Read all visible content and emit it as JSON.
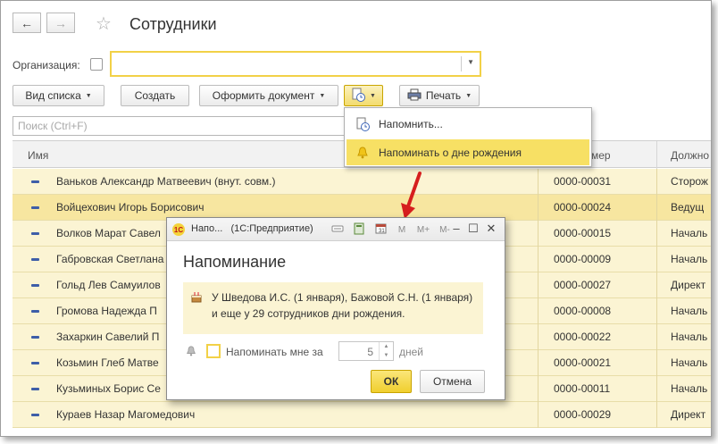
{
  "header": {
    "title": "Сотрудники",
    "back_icon": "←",
    "forward_icon": "→",
    "star_icon": "☆"
  },
  "filter": {
    "org_label": "Организация:"
  },
  "toolbar": {
    "view_list": "Вид списка",
    "create": "Создать",
    "make_document": "Оформить документ",
    "print": "Печать"
  },
  "search": {
    "placeholder": "Поиск (Ctrl+F)"
  },
  "table": {
    "columns": {
      "name": "Имя",
      "number": "мер",
      "position": "Должно"
    },
    "rows": [
      {
        "name": "Ваньков Александр Матвеевич (внут. совм.)",
        "number": "0000-00031",
        "position": "Сторож"
      },
      {
        "name": "Войцехович Игорь Борисович",
        "number": "0000-00024",
        "position": "Ведущ"
      },
      {
        "name": "Волков Марат Савел",
        "number": "0000-00015",
        "position": "Началь"
      },
      {
        "name": "Габровская Светлана",
        "number": "0000-00009",
        "position": "Началь"
      },
      {
        "name": "Гольд Лев Самуилов",
        "number": "0000-00027",
        "position": "Директ"
      },
      {
        "name": "Громова Надежда П",
        "number": "0000-00008",
        "position": "Началь"
      },
      {
        "name": "Захаркин Савелий П",
        "number": "0000-00022",
        "position": "Началь"
      },
      {
        "name": "Козьмин Глеб Матве",
        "number": "0000-00021",
        "position": "Началь"
      },
      {
        "name": "Кузьминых Борис Се",
        "number": "0000-00011",
        "position": "Началь"
      },
      {
        "name": "Кураев Назар Магомедович",
        "number": "0000-00029",
        "position": "Директ"
      }
    ]
  },
  "menu": {
    "remind": "Напомнить...",
    "birthday": "Напоминать о дне рождения"
  },
  "dialog": {
    "title_short": "Напо...",
    "title_app": "(1С:Предприятие)",
    "tool_m": "M",
    "tool_mplus": "M+",
    "tool_mminus": "M-",
    "heading": "Напоминание",
    "note": "У Шведова И.С. (1 января), Бажовой С.Н. (1 января) и еще у 29 сотрудников дни рождения.",
    "remind_label": "Напоминать мне за",
    "days_value": "5",
    "days_label": "дней",
    "ok": "ОК",
    "cancel": "Отмена"
  }
}
